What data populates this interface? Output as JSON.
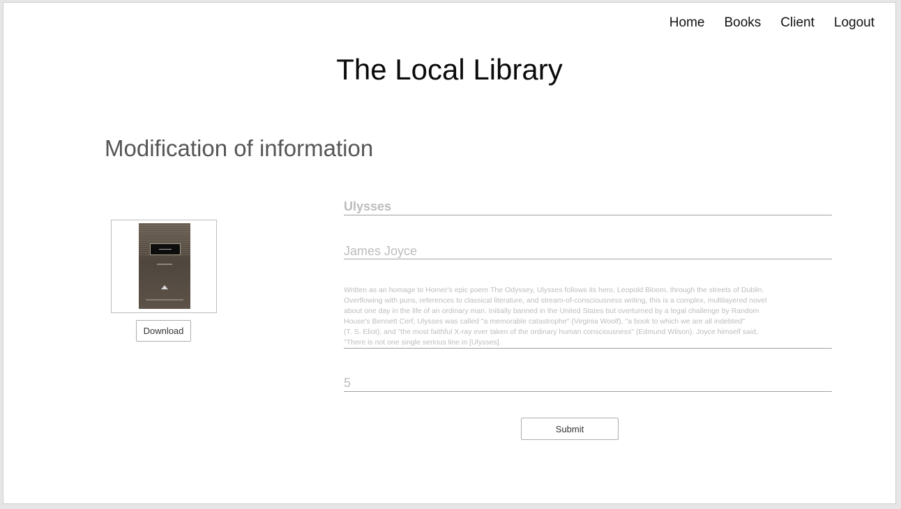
{
  "nav": {
    "items": [
      "Home",
      "Books",
      "Client",
      "Logout"
    ]
  },
  "site_title": "The Local Library",
  "page_heading": "Modification of information",
  "book": {
    "title": "Ulysses",
    "author": "James Joyce",
    "description_lines": [
      "Written as an homage to Homer's epic poem The Odyssey, Ulysses follows its hero, Leopold Bloom, through the streets of Dublin.",
      "Overflowing with puns, references to classical literature, and stream-of-consciousness writing, this is a complex, multilayered novel",
      "about one day in the life of an ordinary man. Initially banned in the United States but overturned by a legal challenge by Random",
      "House's Bennett Cerf, Ulysses was called \"a memorable catastrophe\" (Virginia Woolf), \"a book to which we are all indebted\"",
      "(T. S. Eliot), and \"the most faithful X-ray ever taken of the ordinary human consciousness\" (Edmund Wilson). Joyce himself said,",
      "\"There is not one single serious line in [Ulysses]."
    ],
    "quantity": "5"
  },
  "buttons": {
    "download": "Download",
    "submit": "Submit"
  }
}
